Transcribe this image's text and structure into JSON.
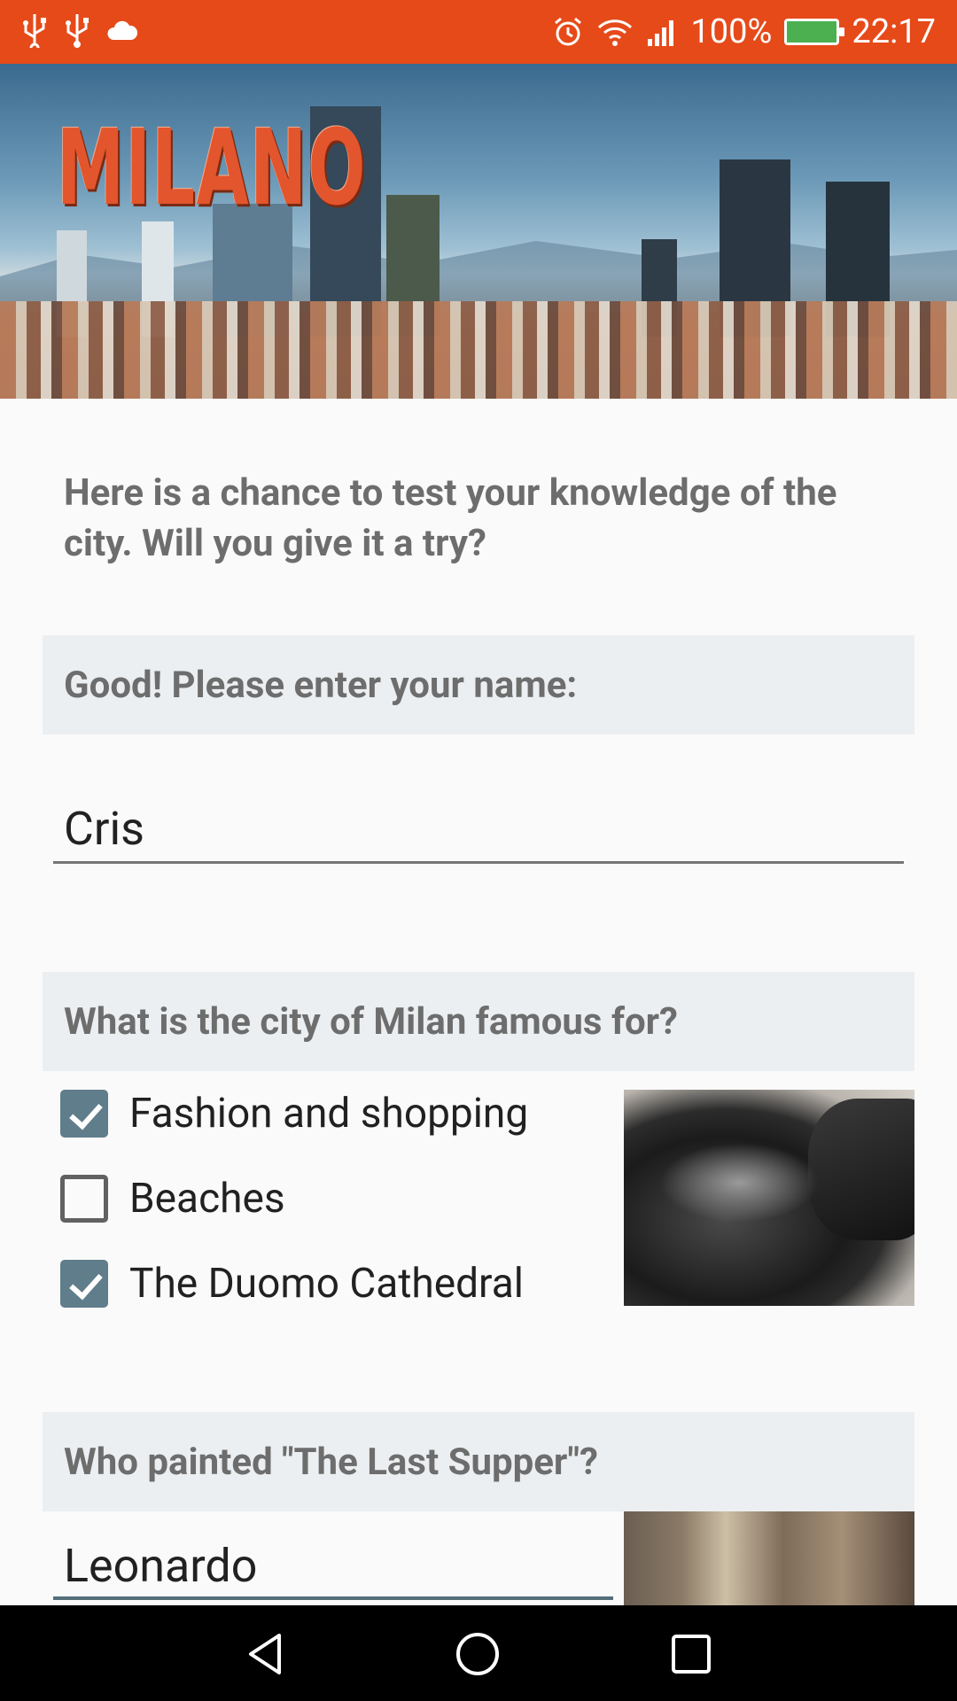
{
  "status_bar": {
    "left_icons": [
      "usb-icon",
      "usb-icon",
      "cloud-icon"
    ],
    "right_icons": [
      "alarm-icon",
      "wifi-icon",
      "signal-icon",
      "battery-icon"
    ],
    "battery_percent": "100%",
    "time": "22:17"
  },
  "header": {
    "logo_text": "MILANO"
  },
  "intro_text": "Here is a chance to test your knowledge of the city. Will you give it a try?",
  "name_section": {
    "question": "Good! Please enter your name:",
    "value": "Cris"
  },
  "fame_section": {
    "question": "What is the city of Milan famous for?",
    "options": [
      {
        "label": "Fashion and shopping",
        "checked": true
      },
      {
        "label": "Beaches",
        "checked": false
      },
      {
        "label": "The Duomo Cathedral",
        "checked": true
      }
    ]
  },
  "painter_section": {
    "question": "Who painted \"The Last Supper\"?",
    "value": "Leonardo"
  },
  "colors": {
    "status_bar": "#e64a19",
    "accent": "#607d8b",
    "question_bg": "#eceff1",
    "question_text": "#6d6d6d"
  },
  "nav_bar": {
    "buttons": [
      "back-icon",
      "home-icon",
      "recents-icon"
    ]
  }
}
